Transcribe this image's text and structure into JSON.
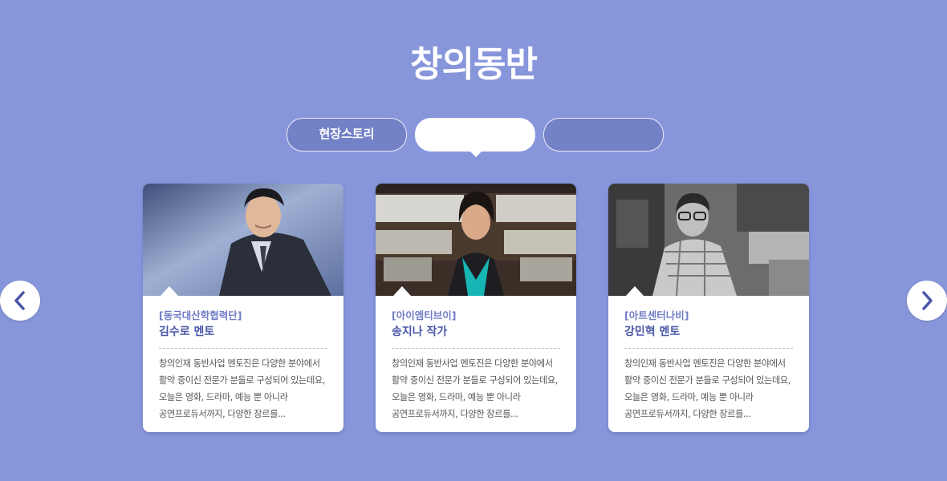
{
  "page": {
    "title": "창의동반"
  },
  "tabs": [
    {
      "label": "현장스토리",
      "active": false
    },
    {
      "label": "",
      "active": true
    },
    {
      "label": "",
      "active": false
    }
  ],
  "cards": [
    {
      "org": "[동국대산학협력단]",
      "name": "김수로 멘토",
      "description": "창의인재 동반사업 멘토진은 다양한 분야에서 활약 중이신 전문가 분들로 구성되어 있는데요, 오늘은 영화, 드라마, 예능 뿐 아니라 공연프로듀서까지, 다양한 장르를...",
      "photo": "man-in-dark-suit-portrait"
    },
    {
      "org": "[아이엠티브이]",
      "name": "송지나 작가",
      "description": "창의인재 동반사업 멘토진은 다양한 분야에서 활약 중이신 전문가 분들로 구성되어 있는데요, 오늘은 영화, 드라마, 예능 뿐 아니라 공연프로듀서까지, 다양한 장르를...",
      "photo": "woman-with-teal-scarf-portrait"
    },
    {
      "org": "[아트센터나비]",
      "name": "강민혁 멘토",
      "description": "창의인재 동반사업 멘토진은 다양한 분야에서 활약 중이신 전문가 분들로 구성되어 있는데요, 오늘은 영화, 드라마, 예능 뿐 아니라 공연프로듀서까지, 다양한 장르를...",
      "photo": "man-with-glasses-plaid-shirt-bw-portrait"
    }
  ],
  "nav": {
    "prev_icon": "chevron-left-icon",
    "next_icon": "chevron-right-icon"
  },
  "colors": {
    "background": "#8796db",
    "accent": "#5b67b3",
    "org_text": "#6f7cc4",
    "name_text": "#4a57a8"
  }
}
